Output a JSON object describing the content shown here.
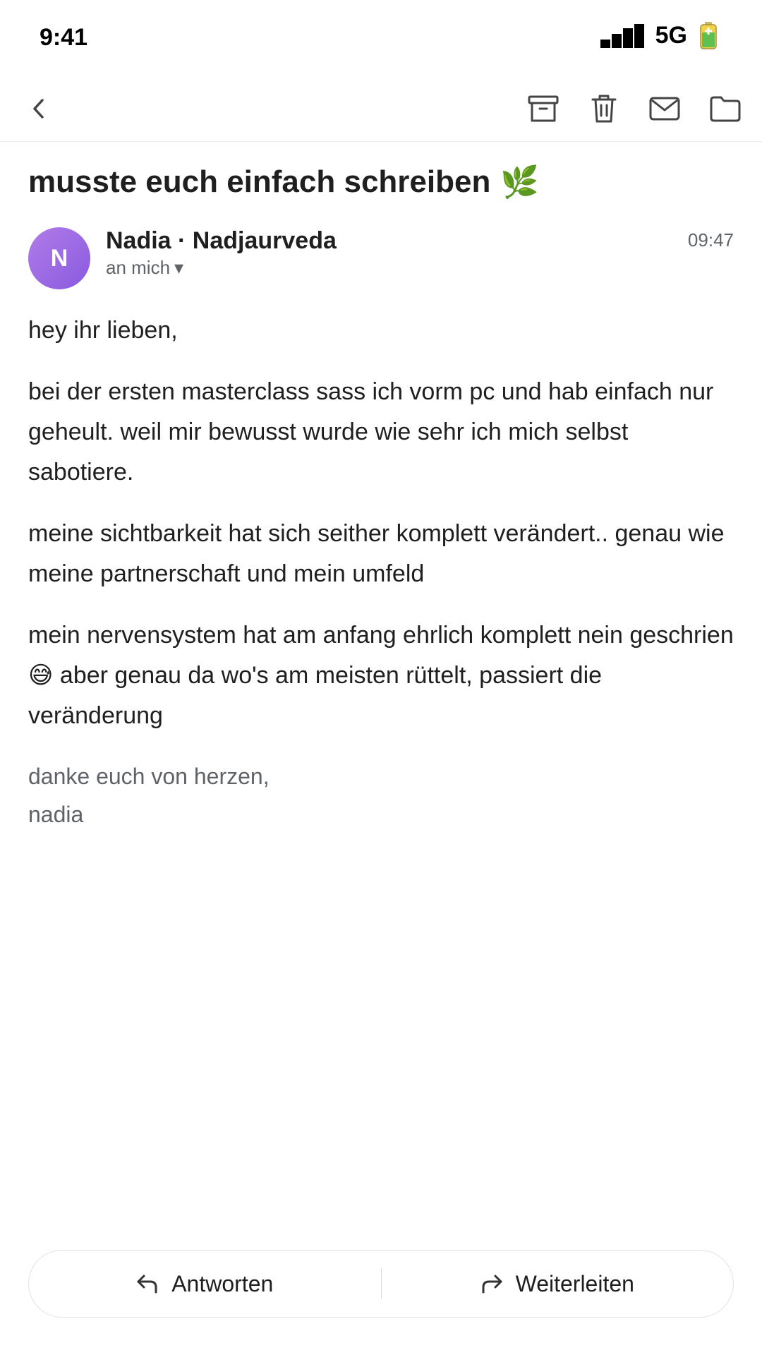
{
  "status_bar": {
    "time": "9:41",
    "network": "5G"
  },
  "icons": {
    "signal": "signal-bars-icon",
    "battery": "battery-icon",
    "back": "chevron-left-icon",
    "archive": "archive-icon",
    "delete": "trash-icon",
    "mail": "mail-icon",
    "folder": "folder-icon",
    "reply": "reply-icon",
    "forward": "forward-icon"
  },
  "email": {
    "subject": "musste euch einfach schreiben",
    "subject_emoji": "🌿",
    "sender": {
      "initial": "N",
      "name": "Nadia · Nadjaurveda",
      "recipient": "an mich",
      "recipient_caret": "▾"
    },
    "time": "09:47",
    "body": {
      "greeting": "hey ihr lieben,",
      "paragraph_1": "bei der ersten masterclass sass ich vorm pc und hab einfach nur geheult. weil mir bewusst wurde wie sehr ich mich selbst sabotiere.",
      "paragraph_2": "meine sichtbarkeit hat sich seither komplett verändert.. genau wie meine partnerschaft und mein umfeld",
      "paragraph_3_start": "mein nervensystem hat am anfang ehrlich komplett nein geschrien",
      "paragraph_3_emoji": "😅",
      "paragraph_3_end": "aber genau da wo's am meisten rüttelt, passiert die veränderung",
      "signoff_line_1": "danke euch von herzen,",
      "signoff_line_2": "nadia"
    }
  },
  "actions": {
    "reply_label": "Antworten",
    "forward_label": "Weiterleiten"
  },
  "colors": {
    "avatar_start": "#b07ce8",
    "avatar_end": "#8a5ae0",
    "text_primary": "#1f1f1f",
    "text_secondary": "#5f6368"
  }
}
